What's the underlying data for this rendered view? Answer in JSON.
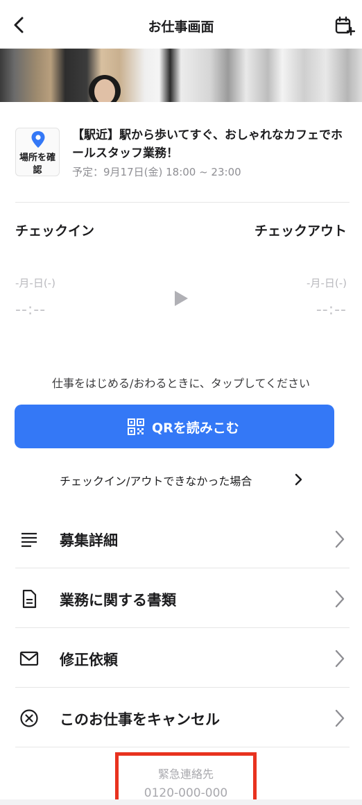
{
  "header": {
    "title": "お仕事画面",
    "back_icon": "chevron-left-icon",
    "calendar_icon": "calendar-add-icon"
  },
  "job": {
    "place_button_label": "場所を確認",
    "place_icon": "map-pin-icon",
    "title": "【駅近】駅から歩いてすぐ、おしゃれなカフェでホールスタッフ業務！",
    "schedule": "予定：9月17日(金) 18:00 ~ 23:00"
  },
  "checkin": {
    "in_label": "チェックイン",
    "out_label": "チェックアウト",
    "in_date": "-月-日(-)",
    "in_time": "--:--",
    "out_date": "-月-日(-)",
    "out_time": "--:--"
  },
  "actions": {
    "hint": "仕事をはじめる/おわるときに、タップしてください",
    "qr_button": "QRを読みこむ",
    "fail_link": "チェックイン/アウトできなかった場合"
  },
  "menu": {
    "items": [
      {
        "label": "募集詳細",
        "icon": "list-icon"
      },
      {
        "label": "業務に関する書類",
        "icon": "document-icon"
      },
      {
        "label": "修正依頼",
        "icon": "mail-icon"
      },
      {
        "label": "このお仕事をキャンセル",
        "icon": "cancel-circle-icon"
      }
    ]
  },
  "emergency": {
    "label": "緊急連絡先",
    "phone": "0120-000-000"
  },
  "colors": {
    "accent": "#3478f6",
    "highlight_border": "#e8321f"
  }
}
